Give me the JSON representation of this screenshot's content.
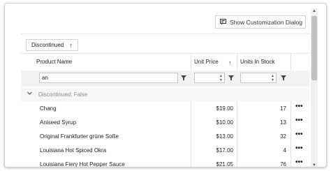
{
  "toolbar": {
    "customize_label": "Show Customization Dialog"
  },
  "group_panel": {
    "chip_label": "Discontinued",
    "chip_sort": "↑"
  },
  "columns": [
    {
      "label": "Product Name"
    },
    {
      "label": "Unit Price",
      "sort": "↑"
    },
    {
      "label": "Units In Stock"
    }
  ],
  "filters": {
    "product_name": "an",
    "unit_price": "",
    "units_in_stock": ""
  },
  "group": {
    "label": "Discontinued: False"
  },
  "rows": [
    {
      "name": "Chang",
      "price": "$19.00",
      "stock": "17"
    },
    {
      "name": "Aniseed Syrup",
      "price": "$10.00",
      "stock": "13"
    },
    {
      "name": "Original Frankfurter grüne Soße",
      "price": "$13.00",
      "stock": "32"
    },
    {
      "name": "Louisiana Hot Spiced Okra",
      "price": "$17.00",
      "stock": "4"
    },
    {
      "name": "Louisiana Fiery Hot Pepper Sauce",
      "price": "$21.05",
      "stock": "76"
    }
  ],
  "row_menu": "•••",
  "icons": [
    "customize-icon",
    "filter-icon",
    "chevron-down-icon",
    "spin-up-icon",
    "spin-down-icon",
    "row-menu-icon"
  ]
}
